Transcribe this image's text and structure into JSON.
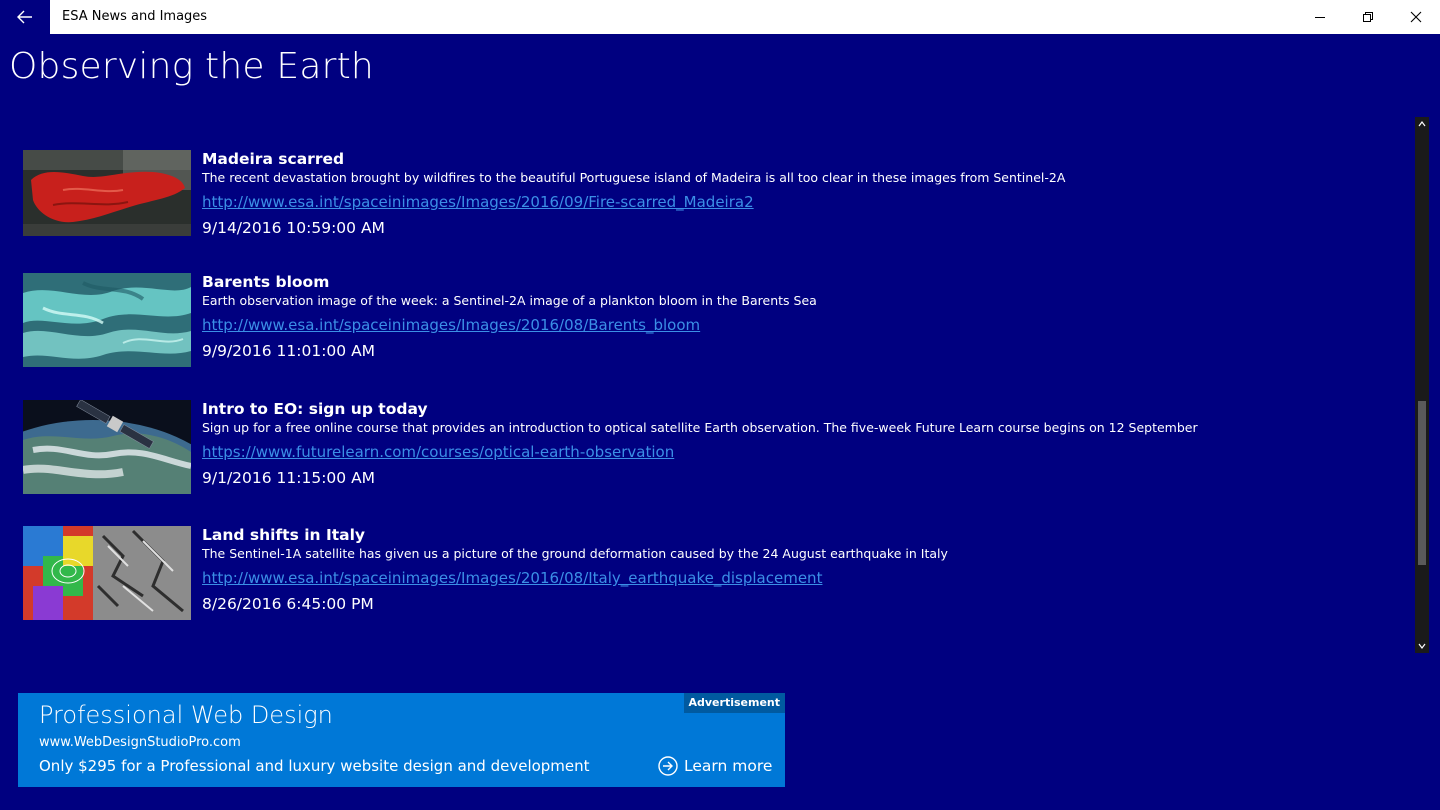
{
  "app": {
    "title": "ESA News and Images"
  },
  "page": {
    "title": "Observing the Earth"
  },
  "items": [
    {
      "title": "Madeira scarred",
      "description": "The recent devastation brought by wildfires to the beautiful Portuguese island of Madeira is all too clear in these images from Sentinel-2A",
      "link": "http://www.esa.int/spaceinimages/Images/2016/09/Fire-scarred_Madeira2",
      "date": "9/14/2016 10:59:00 AM"
    },
    {
      "title": "Barents bloom",
      "description": "Earth observation image of the week: a Sentinel-2A image of a plankton bloom in the Barents Sea",
      "link": "http://www.esa.int/spaceinimages/Images/2016/08/Barents_bloom",
      "date": "9/9/2016 11:01:00 AM"
    },
    {
      "title": "Intro to EO: sign up today",
      "description": "Sign up for a free online course that provides an introduction to optical satellite Earth observation. The five-week Future Learn course begins on 12 September",
      "link": "https://www.futurelearn.com/courses/optical-earth-observation",
      "date": "9/1/2016 11:15:00 AM"
    },
    {
      "title": "Land shifts in Italy",
      "description": "The Sentinel-1A satellite has given us a picture of the ground deformation caused by the 24 August earthquake in Italy",
      "link": "http://www.esa.int/spaceinimages/Images/2016/08/Italy_earthquake_displacement",
      "date": "8/26/2016 6:45:00 PM"
    }
  ],
  "ad": {
    "badge": "Advertisement",
    "title": "Professional Web Design",
    "url": "www.WebDesignStudioPro.com",
    "body": "Only $295 for a Professional and luxury website design and development",
    "cta": "Learn more"
  },
  "colors": {
    "background": "#000080",
    "link": "#3b8fe6",
    "ad_background": "#0078d7"
  },
  "icons": {
    "back": "arrow-left-icon",
    "minimize": "minimize-icon",
    "restore": "restore-icon",
    "close": "close-icon",
    "learn_more": "circle-arrow-right-icon"
  }
}
